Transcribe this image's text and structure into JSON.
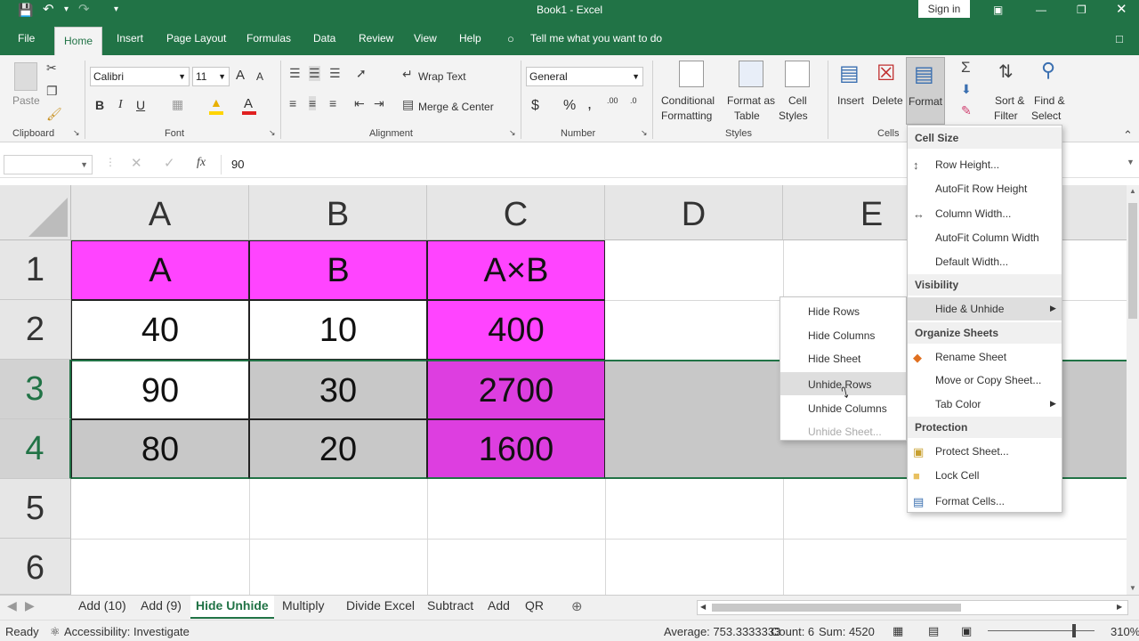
{
  "title_bar": {
    "title": "Book1 - Excel",
    "sign_in": "Sign in"
  },
  "tabs": [
    "File",
    "Home",
    "Insert",
    "Page Layout",
    "Formulas",
    "Data",
    "Review",
    "View",
    "Help"
  ],
  "tell_me": "Tell me what you want to do",
  "ribbon": {
    "clipboard": {
      "paste": "Paste",
      "label": "Clipboard"
    },
    "font": {
      "name": "Calibri",
      "size": "11",
      "bold": "B",
      "italic": "I",
      "underline": "U",
      "grow": "A",
      "shrink": "A",
      "label": "Font"
    },
    "alignment": {
      "wrap": "Wrap Text",
      "merge": "Merge & Center",
      "label": "Alignment"
    },
    "number": {
      "format": "General",
      "currency": "$",
      "percent": "%",
      "comma": ",",
      "label": "Number"
    },
    "styles": {
      "conditional": "Conditional",
      "conditional2": "Formatting",
      "format_as": "Format as",
      "format_as2": "Table",
      "cell_styles": "Cell",
      "cell_styles2": "Styles",
      "label": "Styles"
    },
    "cells": {
      "insert": "Insert",
      "delete": "Delete",
      "format": "Format",
      "label": "Cells"
    },
    "editing": {
      "sort": "Sort &",
      "sort2": "Filter",
      "find": "Find &",
      "find2": "Select"
    }
  },
  "formula_bar": {
    "fx": "fx",
    "value": "90"
  },
  "columns": [
    "A",
    "B",
    "C",
    "D",
    "E"
  ],
  "rows": [
    "1",
    "2",
    "3",
    "4",
    "5",
    "6"
  ],
  "cells": [
    [
      "A",
      "B",
      "A×B"
    ],
    [
      "40",
      "10",
      "400"
    ],
    [
      "90",
      "30",
      "2700"
    ],
    [
      "80",
      "20",
      "1600"
    ]
  ],
  "colors": {
    "excel_green": "#217346",
    "magenta": "#ff44ff",
    "magenta_dark": "#dd3ee0",
    "selected_gray": "#c8c8c8"
  },
  "format_menu": {
    "cell_size": "Cell Size",
    "row_height": "Row Height...",
    "autofit_row": "AutoFit Row Height",
    "column_width": "Column Width...",
    "autofit_col": "AutoFit Column Width",
    "default_width": "Default Width...",
    "visibility": "Visibility",
    "hide_unhide": "Hide & Unhide",
    "organize": "Organize Sheets",
    "rename": "Rename Sheet",
    "move_copy": "Move or Copy Sheet...",
    "tab_color": "Tab Color",
    "protection": "Protection",
    "protect_sheet": "Protect Sheet...",
    "lock_cell": "Lock Cell",
    "format_cells": "Format Cells..."
  },
  "hide_submenu": [
    "Hide Rows",
    "Hide Columns",
    "Hide Sheet",
    "Unhide Rows",
    "Unhide Columns",
    "Unhide Sheet..."
  ],
  "sheet_tabs": [
    "Add (10)",
    "Add (9)",
    "Hide Unhide",
    "Multiply",
    "Divide Excel",
    "Subtract",
    "Add",
    "QR"
  ],
  "status": {
    "ready": "Ready",
    "accessibility": "Accessibility: Investigate",
    "average": "Average: 753.3333333",
    "count": "Count: 6",
    "sum": "Sum: 4520",
    "zoom": "310%"
  }
}
